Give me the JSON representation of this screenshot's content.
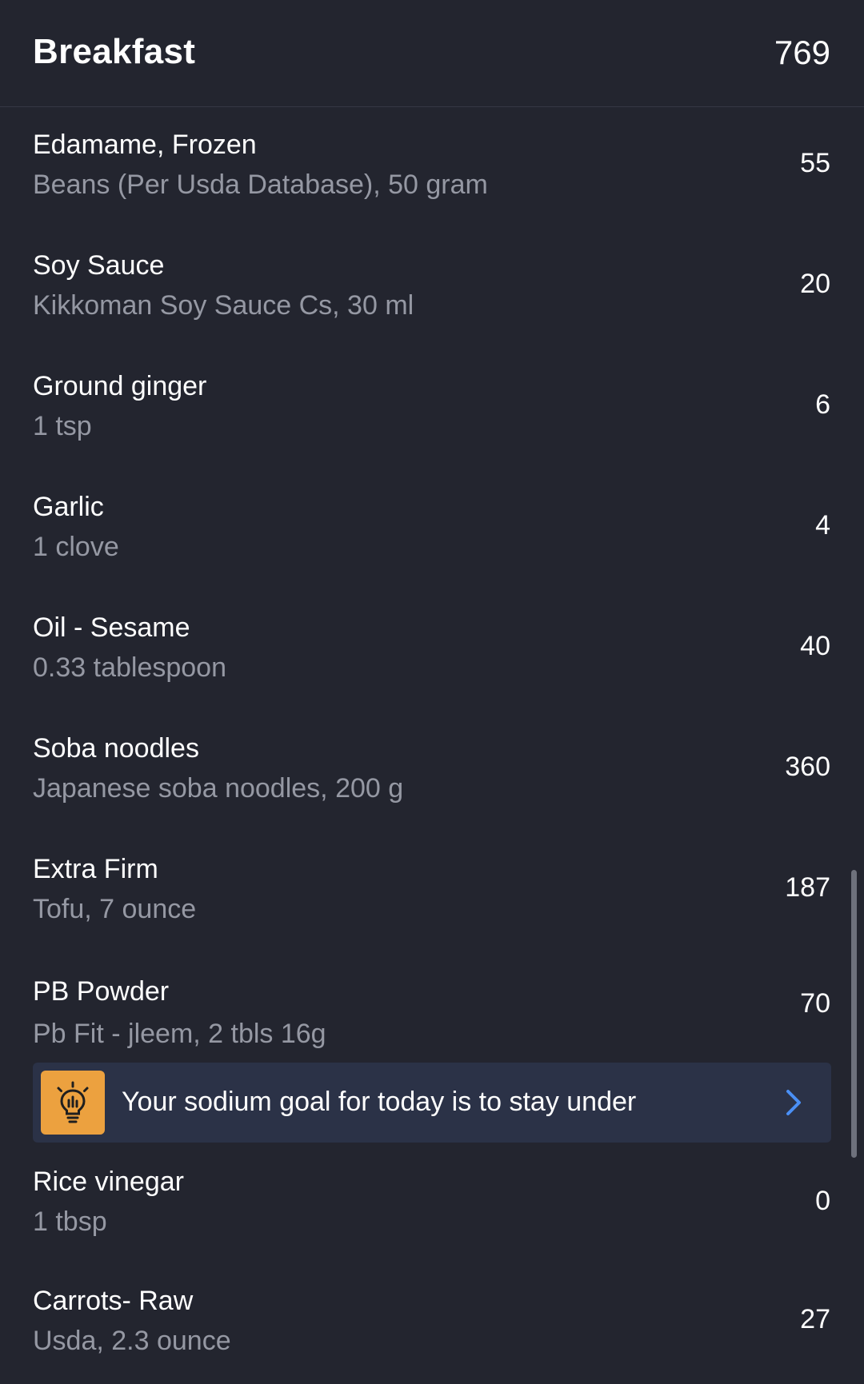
{
  "meal": {
    "title": "Breakfast",
    "total_calories": "769"
  },
  "items": [
    {
      "name": "Edamame, Frozen",
      "desc": "Beans (Per Usda Database), 50 gram",
      "calories": "55"
    },
    {
      "name": "Soy Sauce",
      "desc": "Kikkoman Soy Sauce Cs, 30 ml",
      "calories": "20"
    },
    {
      "name": "Ground ginger",
      "desc": "1 tsp",
      "calories": "6"
    },
    {
      "name": "Garlic",
      "desc": "1 clove",
      "calories": "4"
    },
    {
      "name": "Oil - Sesame",
      "desc": "0.33 tablespoon",
      "calories": "40"
    },
    {
      "name": "Soba noodles",
      "desc": "Japanese soba noodles, 200 g",
      "calories": "360"
    },
    {
      "name": "Extra Firm",
      "desc": "Tofu, 7 ounce",
      "calories": "187"
    },
    {
      "name": "PB Powder",
      "desc": "Pb Fit - jleem, 2 tbls 16g",
      "calories": "70"
    },
    {
      "name": "Rice vinegar",
      "desc": "1 tbsp",
      "calories": "0"
    },
    {
      "name": "Carrots- Raw",
      "desc": "Usda, 2.3 ounce",
      "calories": "27"
    }
  ],
  "tip": {
    "text": "Your sodium goal for today is to stay under",
    "icon": "lightbulb-icon",
    "icon_bg_color": "#eca13f",
    "chevron_color": "#4a8ff5"
  },
  "colors": {
    "background": "#23252f",
    "primary_text": "#ffffff",
    "secondary_text": "#9598a3",
    "tip_background": "#2b3247"
  }
}
